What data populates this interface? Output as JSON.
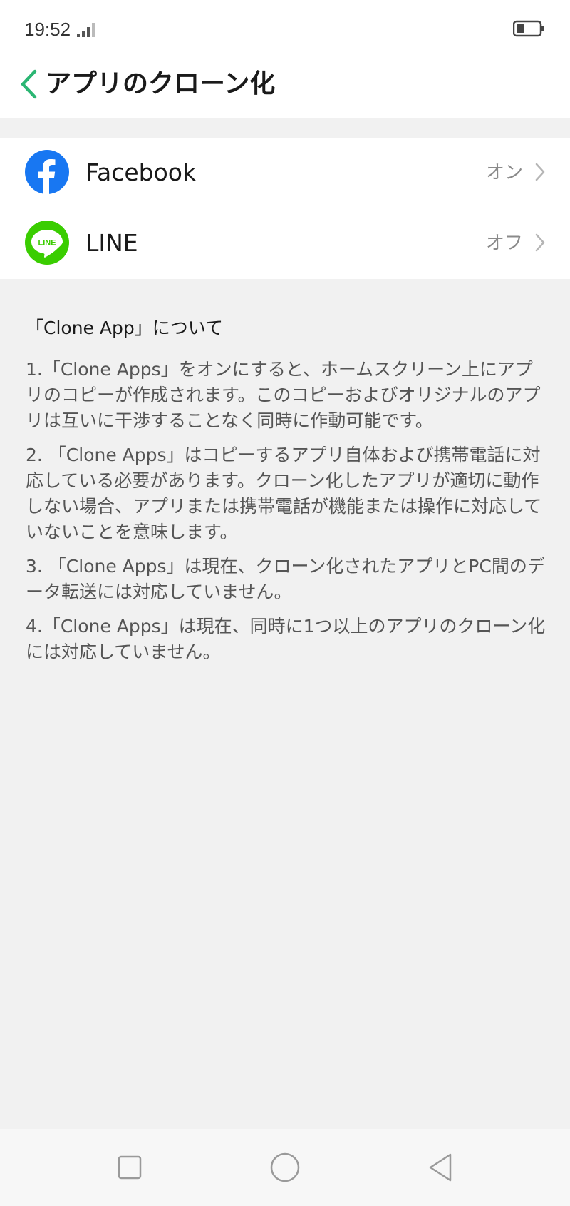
{
  "status_bar": {
    "time": "19:52"
  },
  "header": {
    "title": "アプリのクローン化"
  },
  "apps": [
    {
      "name": "Facebook",
      "status": "オン",
      "icon": "facebook-icon"
    },
    {
      "name": "LINE",
      "status": "オフ",
      "icon": "line-icon",
      "icon_text": "LINE"
    }
  ],
  "about": {
    "title": "「Clone App」について",
    "items": [
      "1.「Clone Apps」をオンにすると、ホームスクリーン上にアプリのコピーが作成されます。このコピーおよびオリジナルのアプリは互いに干渉することなく同時に作動可能です。",
      "2. 「Clone Apps」はコピーするアプリ自体および携帯電話に対応している必要があります。クローン化したアプリが適切に動作しない場合、アプリまたは携帯電話が機能または操作に対応していないことを意味します。",
      "3. 「Clone Apps」は現在、クローン化されたアプリとPC間のデータ転送には対応していません。",
      "4.「Clone Apps」は現在、同時に1つ以上のアプリのクローン化には対応していません。"
    ]
  },
  "colors": {
    "accent": "#2bb673",
    "facebook": "#1877f2",
    "line": "#3acd01"
  }
}
